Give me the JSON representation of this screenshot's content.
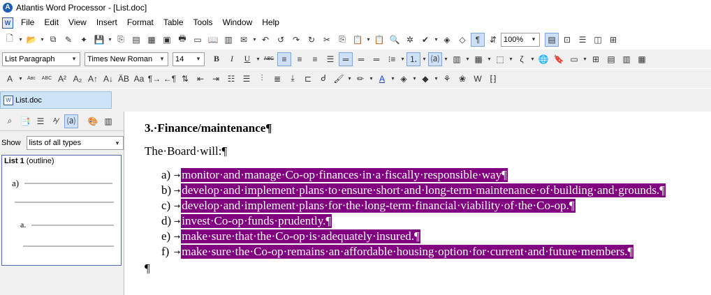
{
  "window": {
    "title": "Atlantis Word Processor - [List.doc]",
    "logo": "A"
  },
  "menu": [
    "File",
    "Edit",
    "View",
    "Insert",
    "Format",
    "Table",
    "Tools",
    "Window",
    "Help"
  ],
  "toolbar": {
    "zoom": "100%",
    "style": "List Paragraph",
    "font": "Times New Roman",
    "size": "14",
    "bold_label": "B",
    "italic_label": "I",
    "underline_label": "U",
    "pilcrow_label": "¶",
    "abc_label": "ABC"
  },
  "tab": {
    "label": "List.doc"
  },
  "sidebar": {
    "show_label": "Show",
    "show_value": "lists of all types",
    "list_title_bold": "List 1",
    "list_title_rest": " (outline)",
    "level1_marker": "a)",
    "level2_marker": "a."
  },
  "document": {
    "heading": "3.·Finance/maintenance¶",
    "intro": "The·Board·will:¶",
    "items": [
      {
        "marker": "a)",
        "text": "monitor·and·manage·Co-op·finances·in·a·fiscally·responsible·way¶"
      },
      {
        "marker": "b)",
        "text": "develop·and·implement·plans·to·ensure·short·and·long-term·maintenance·of·building·and·grounds.¶"
      },
      {
        "marker": "c)",
        "text": "develop·and·implement·plans·for·the·long-term·financial·viability·of·the·Co-op.¶"
      },
      {
        "marker": "d)",
        "text": "invest·Co-op·funds·prudently.¶"
      },
      {
        "marker": "e)",
        "text": "make·sure·that·the·Co-op·is·adequately·insured.¶"
      },
      {
        "marker": "f)",
        "text": "make·sure·the·Co-op·remains·an·affordable·housing·option·for·current·and·future·members.¶"
      }
    ],
    "trailing_pilcrow": "¶"
  },
  "colors": {
    "selection": "#800080",
    "tab_bg": "#cde3f7"
  }
}
